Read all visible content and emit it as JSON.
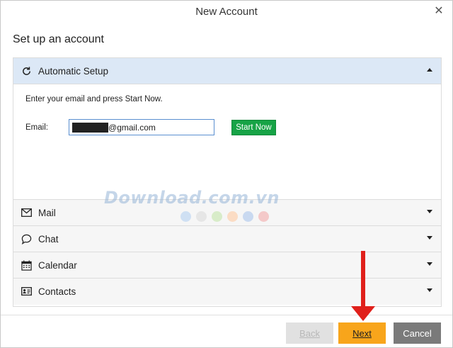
{
  "window": {
    "title": "New Account",
    "close_glyph": "✕"
  },
  "heading": "Set up an account",
  "sections": {
    "automatic": {
      "label": "Automatic Setup",
      "icon": "refresh-icon",
      "instructions": "Enter your email and press Start Now.",
      "email_label": "Email:",
      "email_value": "██████@gmail.com",
      "start_label": "Start Now"
    },
    "mail": {
      "label": "Mail",
      "icon": "envelope-icon"
    },
    "chat": {
      "label": "Chat",
      "icon": "speech-bubble-icon"
    },
    "calendar": {
      "label": "Calendar",
      "icon": "calendar-icon"
    },
    "contacts": {
      "label": "Contacts",
      "icon": "contact-card-icon"
    }
  },
  "watermark": {
    "text": "Download.com.vn",
    "dot_colors": [
      "#cfe0f3",
      "#e6e6e6",
      "#d8ecc9",
      "#fbdcc4",
      "#c9d9f0",
      "#f4c9c9"
    ]
  },
  "footer": {
    "back_label": "Back",
    "next_label": "Next",
    "cancel_label": "Cancel"
  },
  "colors": {
    "active_header": "#dce8f6",
    "start_button": "#17a346",
    "next_button": "#f8a51b",
    "cancel_button": "#7a7a7a",
    "arrow": "#e0201b"
  }
}
